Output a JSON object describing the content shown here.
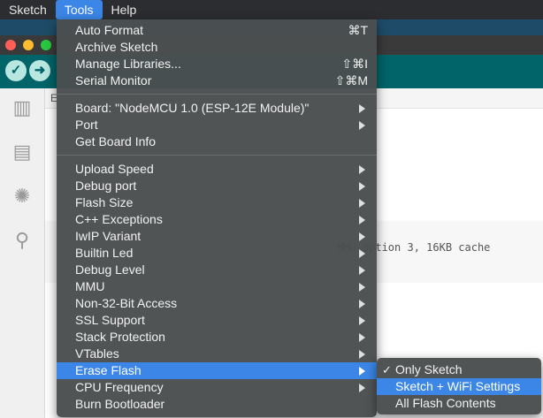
{
  "menubar": {
    "items": [
      {
        "label": "Sketch"
      },
      {
        "label": "Tools"
      },
      {
        "label": "Help"
      }
    ]
  },
  "editor": {
    "tab_fragment": "E",
    "output_line": "MMU option 3, 16KB cache"
  },
  "tools_menu": {
    "items": [
      {
        "label": "Auto Format",
        "shortcut": "⌘T"
      },
      {
        "label": "Archive Sketch",
        "shortcut": ""
      },
      {
        "label": "Manage Libraries...",
        "shortcut": "⇧⌘I"
      },
      {
        "label": "Serial Monitor",
        "shortcut": "⇧⌘M"
      },
      {
        "label": "Board: \"NodeMCU 1.0 (ESP-12E Module)\"",
        "submenu": true
      },
      {
        "label": "Port",
        "submenu": true
      },
      {
        "label": "Get Board Info"
      },
      {
        "label": "Upload Speed",
        "submenu": true
      },
      {
        "label": "Debug port",
        "submenu": true
      },
      {
        "label": "Flash Size",
        "submenu": true
      },
      {
        "label": "C++ Exceptions",
        "submenu": true
      },
      {
        "label": "IwIP Variant",
        "submenu": true
      },
      {
        "label": "Builtin Led",
        "submenu": true
      },
      {
        "label": "Debug Level",
        "submenu": true
      },
      {
        "label": "MMU",
        "submenu": true
      },
      {
        "label": "Non-32-Bit Access",
        "submenu": true
      },
      {
        "label": "SSL Support",
        "submenu": true
      },
      {
        "label": "Stack Protection",
        "submenu": true
      },
      {
        "label": "VTables",
        "submenu": true
      },
      {
        "label": "Erase Flash",
        "submenu": true,
        "highlighted": true
      },
      {
        "label": "CPU Frequency",
        "submenu": true
      },
      {
        "label": "Burn Bootloader"
      }
    ]
  },
  "erase_flash_submenu": {
    "items": [
      {
        "label": "Only Sketch",
        "checked": true,
        "check_mark": "✓"
      },
      {
        "label": "Sketch + WiFi Settings",
        "highlighted": true
      },
      {
        "label": "All Flash Contents"
      }
    ]
  },
  "colors": {
    "highlight": "#3b86e6",
    "toolbar": "#006468",
    "menu_bg": "#4a4e50"
  }
}
